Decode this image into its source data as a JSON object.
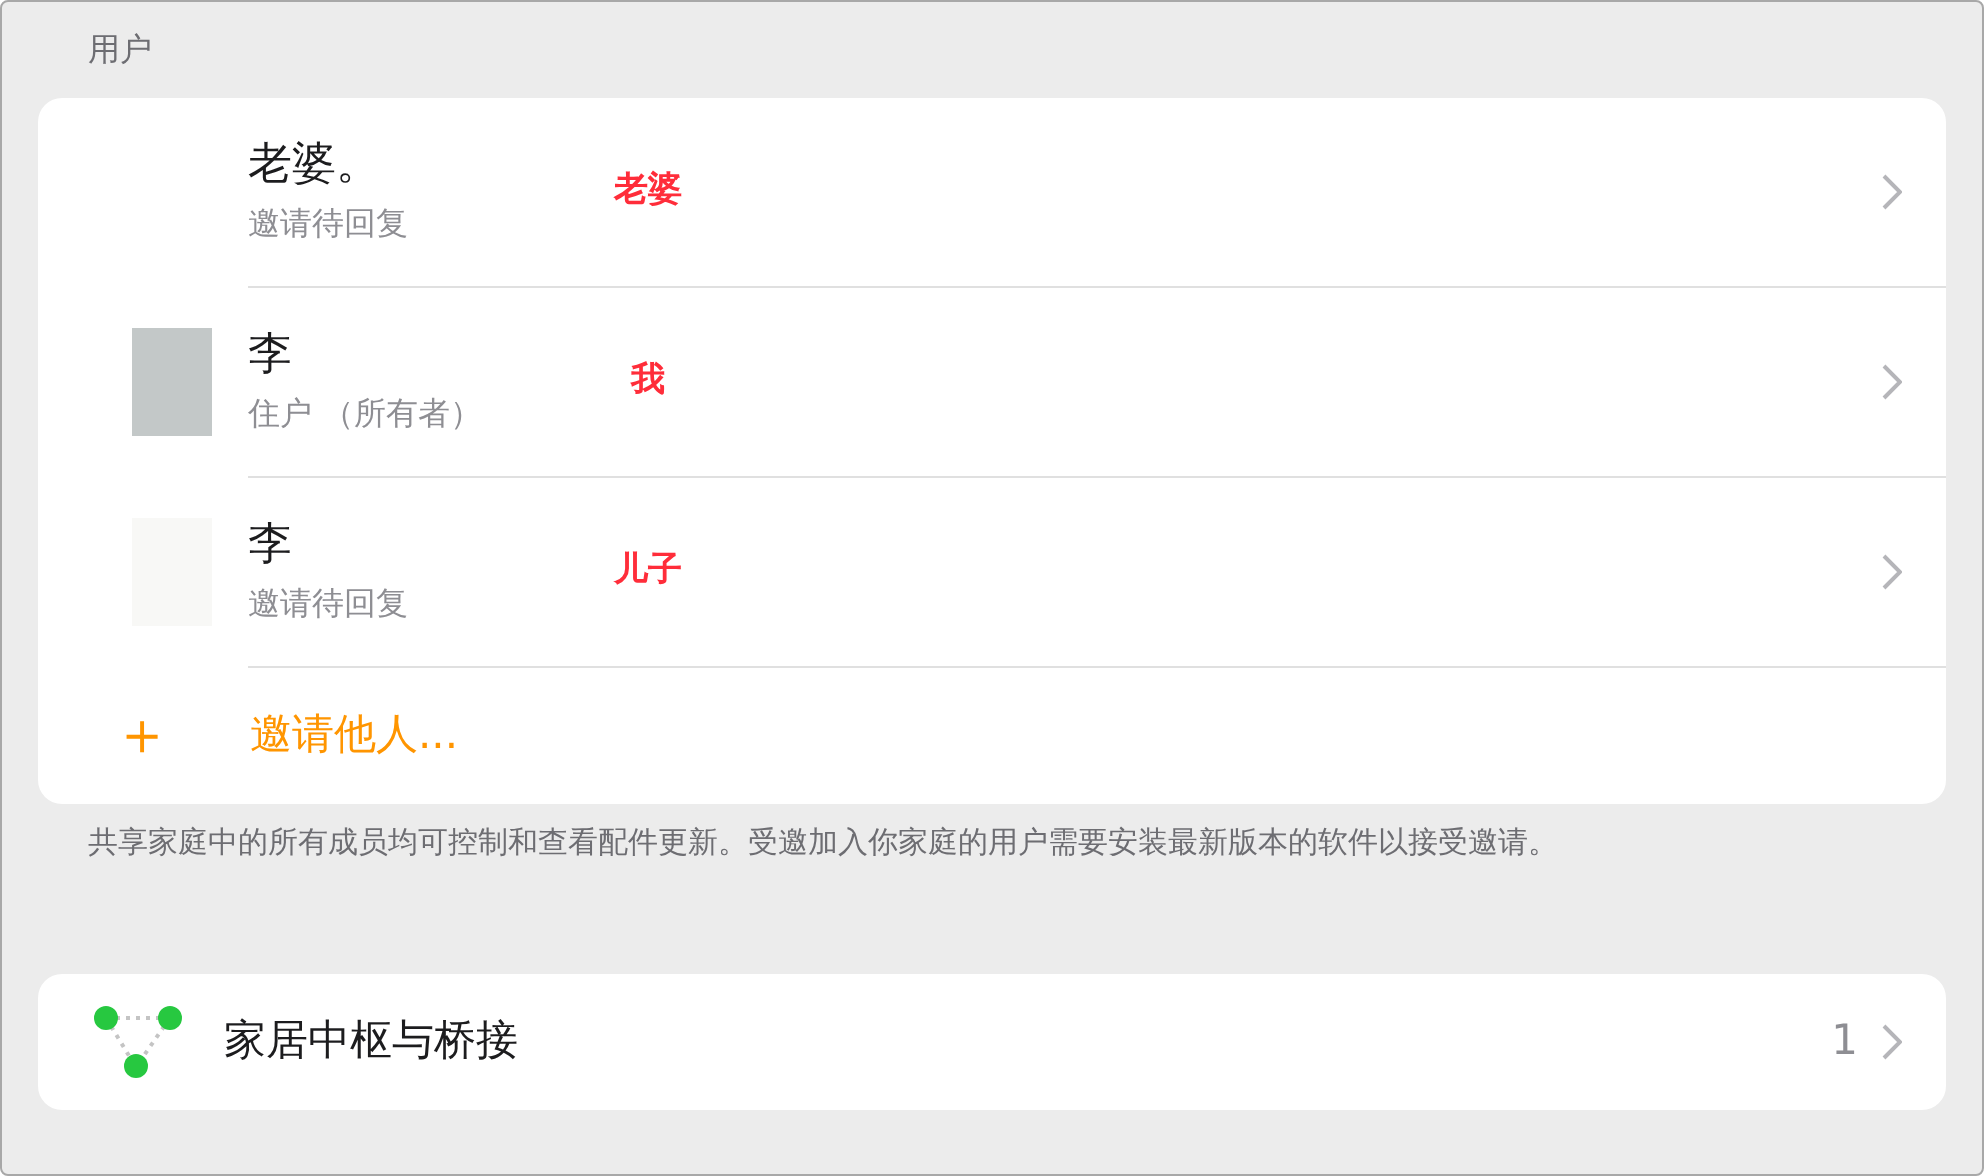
{
  "section_header": "用户",
  "users": [
    {
      "name": "老婆。",
      "status": "邀请待回复",
      "annotation": "老婆"
    },
    {
      "name": "李",
      "status": "住户 （所有者）",
      "annotation": "我",
      "color": "#c3c8c8"
    },
    {
      "name": "李",
      "status": "邀请待回复",
      "annotation": "儿子",
      "color": "#f8f8f6"
    }
  ],
  "invite": {
    "icon": "＋",
    "label": "邀请他人..."
  },
  "footer": "共享家庭中的所有成员均可控制和查看配件更新。受邀加入你家庭的用户需要安装最新版本的软件以接受邀请。",
  "hubs": {
    "label": "家居中枢与桥接",
    "count": "1"
  }
}
